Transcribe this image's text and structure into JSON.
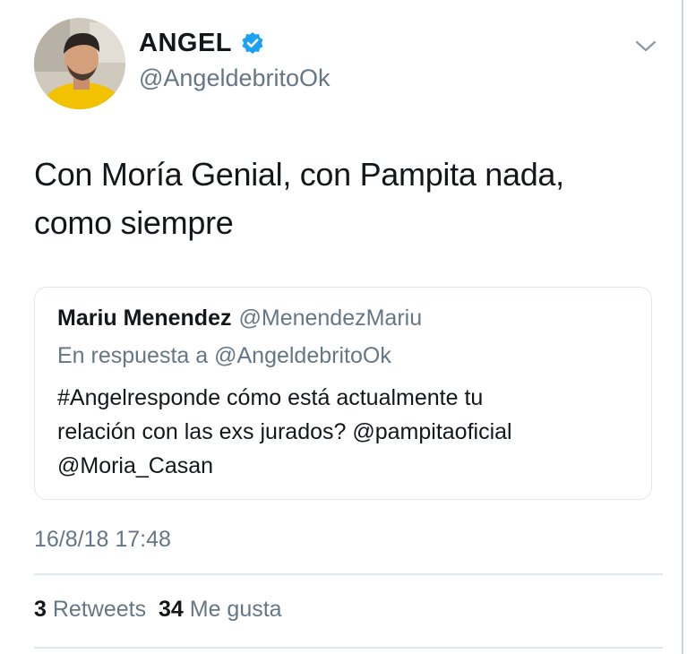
{
  "author": {
    "display_name": "ANGEL",
    "handle": "@AngeldebritoOk",
    "verified": true,
    "verified_color": "#1da1f2"
  },
  "tweet": {
    "text_line1": "Con Moría Genial, con Pampita nada,",
    "text_line2": "como siempre",
    "timestamp": "16/8/18 17:48"
  },
  "quoted_tweet": {
    "author_name": "Mariu Menendez",
    "author_handle": "@MenendezMariu",
    "reply_to": "En respuesta a @AngeldebritoOk",
    "text_line1": "#Angelresponde cómo está actualmente tu",
    "text_line2": "relación con las exs jurados? @pampitaoficial",
    "text_line3": "@Moria_Casan"
  },
  "stats": {
    "retweets_count": "3",
    "retweets_label": "Retweets",
    "likes_count": "34",
    "likes_label": "Me gusta"
  },
  "icons": {
    "menu": "chevron-down-icon",
    "verified": "verified-badge-icon"
  }
}
